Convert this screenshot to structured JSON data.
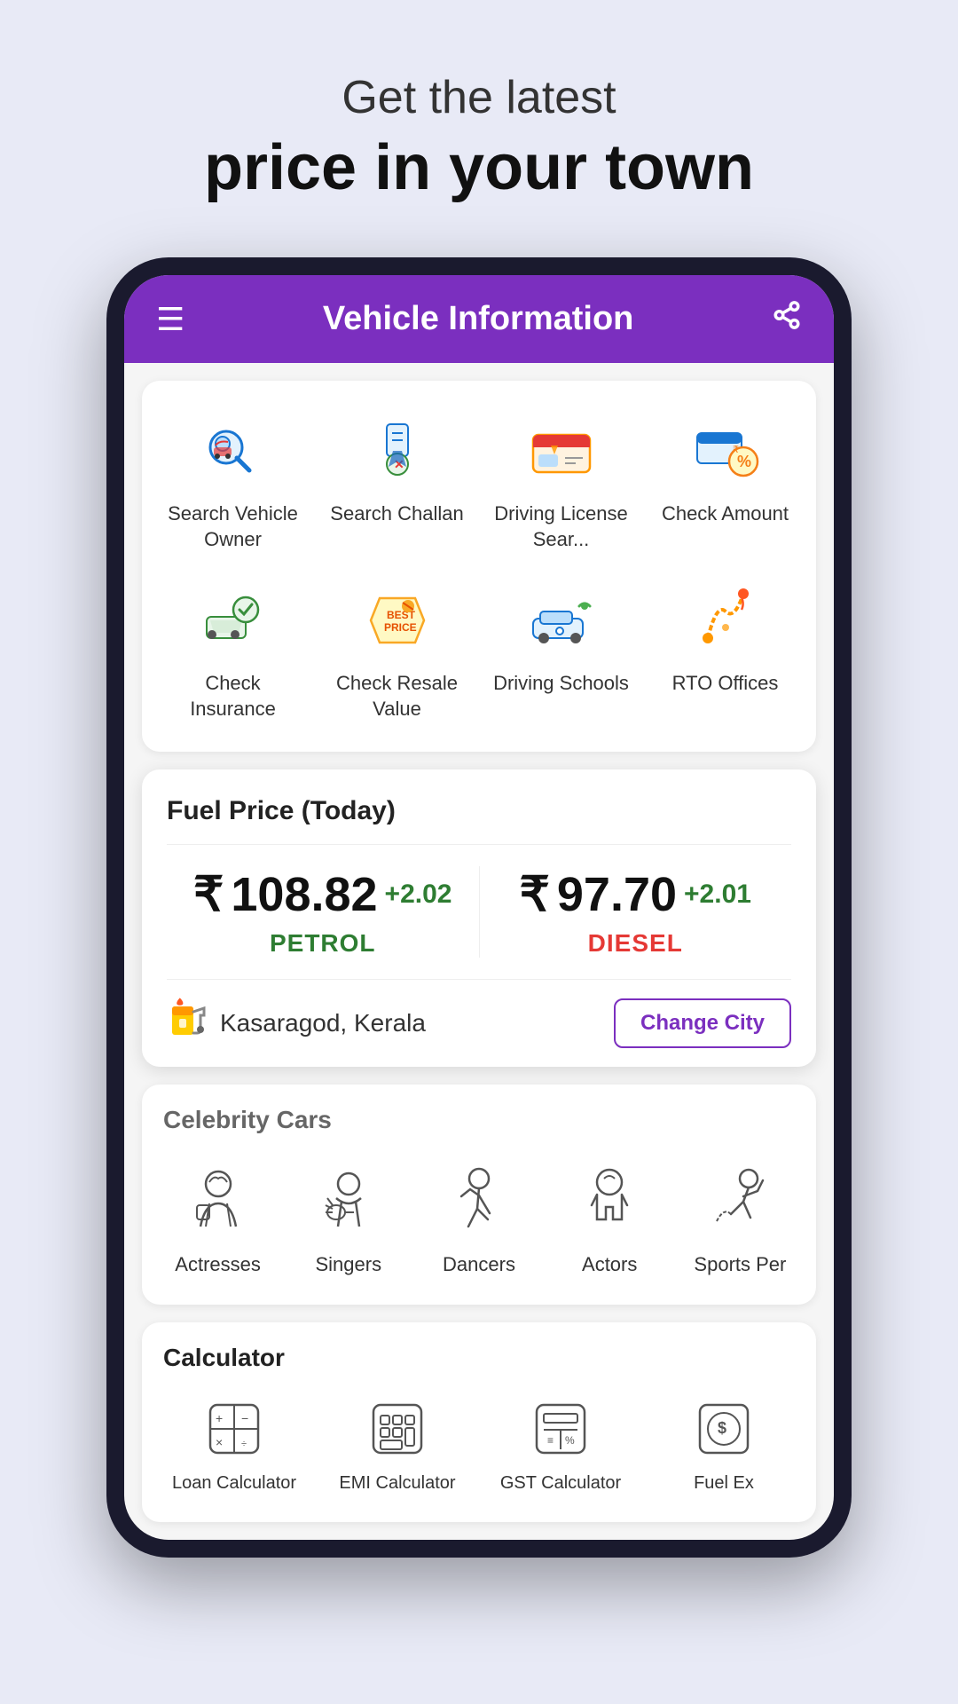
{
  "hero": {
    "subtitle": "Get the latest",
    "title": "price in your town"
  },
  "app": {
    "header": {
      "title": "Vehicle Information",
      "menu_label": "☰",
      "share_label": "⬆"
    },
    "vehicle_grid": {
      "row1": [
        {
          "id": "search-vehicle-owner",
          "label": "Search Vehicle Owner",
          "icon": "🔍"
        },
        {
          "id": "search-challan",
          "label": "Search Challan",
          "icon": "👮"
        },
        {
          "id": "driving-license",
          "label": "Driving License Sear...",
          "icon": "🪪"
        },
        {
          "id": "check-amount",
          "label": "Check Amount",
          "icon": "💰"
        }
      ],
      "row2": [
        {
          "id": "check-insurance",
          "label": "Check Insurance",
          "icon": "🚗"
        },
        {
          "id": "check-resale",
          "label": "Check Resale Value",
          "icon": "🏷️"
        },
        {
          "id": "driving-schools",
          "label": "Driving Schools",
          "icon": "🚙"
        },
        {
          "id": "rto-offices",
          "label": "RTO Offices",
          "icon": "🗺️"
        }
      ]
    },
    "fuel": {
      "title": "Fuel Price (Today)",
      "petrol": {
        "symbol": "₹",
        "amount": "108.82",
        "change": "+2.02",
        "label": "PETROL"
      },
      "diesel": {
        "symbol": "₹",
        "amount": "97.70",
        "change": "+2.01",
        "label": "DIESEL"
      },
      "city": "Kasaragod, Kerala",
      "change_city_label": "Change City",
      "pump_icon": "⛽"
    },
    "celebrity": {
      "title": "Celebrity Cars",
      "items": [
        {
          "id": "actresses",
          "label": "Actresses",
          "icon": "👩‍🎤"
        },
        {
          "id": "singers",
          "label": "Singers",
          "icon": "🎸"
        },
        {
          "id": "dancers",
          "label": "Dancers",
          "icon": "💃"
        },
        {
          "id": "actors",
          "label": "Actors",
          "icon": "🎭"
        },
        {
          "id": "sports-persons",
          "label": "Sports Per",
          "icon": "⛷️"
        }
      ]
    },
    "calculator": {
      "title": "Calculator",
      "items": [
        {
          "id": "loan-calculator",
          "label": "Loan Calculator",
          "icon": "🧮"
        },
        {
          "id": "emi-calculator",
          "label": "EMI Calculator",
          "icon": "📊"
        },
        {
          "id": "gst-calculator",
          "label": "GST Calculator",
          "icon": "🧾"
        },
        {
          "id": "fuel-ex",
          "label": "Fuel Ex",
          "icon": "💵"
        }
      ]
    }
  }
}
